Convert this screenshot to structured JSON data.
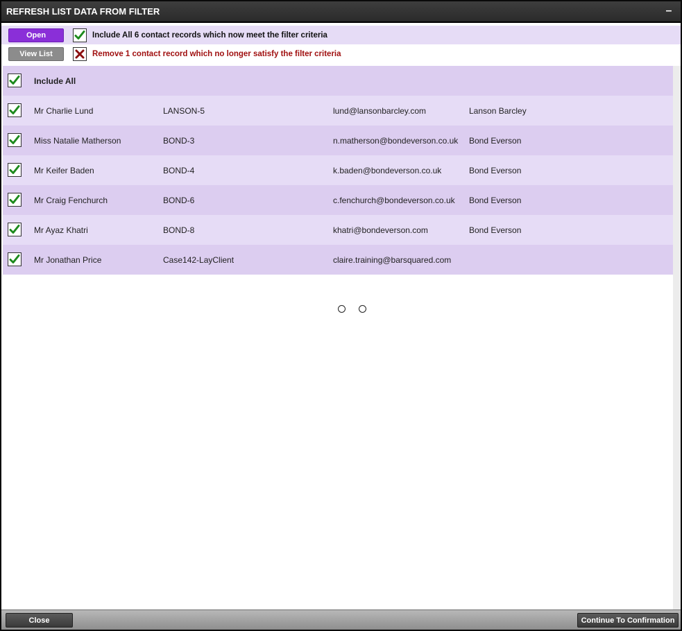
{
  "dialog": {
    "title": "REFRESH LIST DATA FROM FILTER",
    "minimize_glyph": "–"
  },
  "options": {
    "open_label": "Open",
    "include_text": "Include All 6 contact records which now meet the filter criteria",
    "view_list_label": "View List",
    "remove_text": "Remove 1 contact record which no longer satisfy the filter criteria"
  },
  "list": {
    "include_all_label": "Include All",
    "rows": [
      {
        "name": "Mr Charlie Lund",
        "ref": "LANSON-5",
        "email": "lund@lansonbarcley.com",
        "company": "Lanson Barcley"
      },
      {
        "name": "Miss Natalie Matherson",
        "ref": "BOND-3",
        "email": "n.matherson@bondeverson.co.uk",
        "company": "Bond Everson"
      },
      {
        "name": "Mr Keifer Baden",
        "ref": "BOND-4",
        "email": "k.baden@bondeverson.co.uk",
        "company": "Bond Everson"
      },
      {
        "name": "Mr Craig Fenchurch",
        "ref": "BOND-6",
        "email": "c.fenchurch@bondeverson.co.uk",
        "company": "Bond Everson"
      },
      {
        "name": "Mr Ayaz Khatri",
        "ref": "BOND-8",
        "email": "khatri@bondeverson.com",
        "company": "Bond Everson"
      },
      {
        "name": "Mr Jonathan Price",
        "ref": "Case142-LayClient",
        "email": "claire.training@barsquared.com",
        "company": ""
      }
    ]
  },
  "footer": {
    "close_label": "Close",
    "continue_label": "Continue To Confirmation"
  },
  "colors": {
    "check_green": "#1d8a1d",
    "cross_red": "#8b1010",
    "accent_purple": "#8a2fd8"
  }
}
